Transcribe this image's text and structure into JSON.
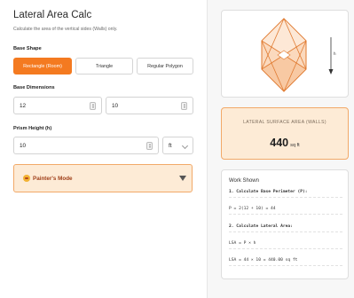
{
  "app": {
    "title": "Lateral Area Calc",
    "subtitle": "Calculate the area of the vertical sides (Walls) only."
  },
  "base_shape": {
    "label": "Base Shape",
    "options": [
      "Rectangle (Room)",
      "Triangle",
      "Regular Polygon"
    ],
    "selected": "Rectangle (Room)"
  },
  "dimensions": {
    "label": "Base Dimensions",
    "length": "12",
    "width": "10"
  },
  "height": {
    "label": "Prism Height (h)",
    "value": "10",
    "unit": "ft"
  },
  "painter": {
    "label": "Painter's Mode",
    "icon": "palette-icon"
  },
  "diagram": {
    "height_label": "h"
  },
  "result": {
    "label": "LATERAL SURFACE AREA (WALLS)",
    "value": "440",
    "unit": "sq ft"
  },
  "work": {
    "title": "Work Shown",
    "lines": [
      "1. Calculate Base Perimeter (P):",
      "P = 2(12 + 10) = 44",
      "2. Calculate Lateral Area:",
      "LSA = P × h",
      "LSA = 44 × 10 = 440.00 sq ft"
    ]
  },
  "colors": {
    "accent": "#f47a20",
    "accent_light": "#fdebd6",
    "prism_stroke": "#e07a30",
    "prism_fill": "#fbd9bd"
  }
}
